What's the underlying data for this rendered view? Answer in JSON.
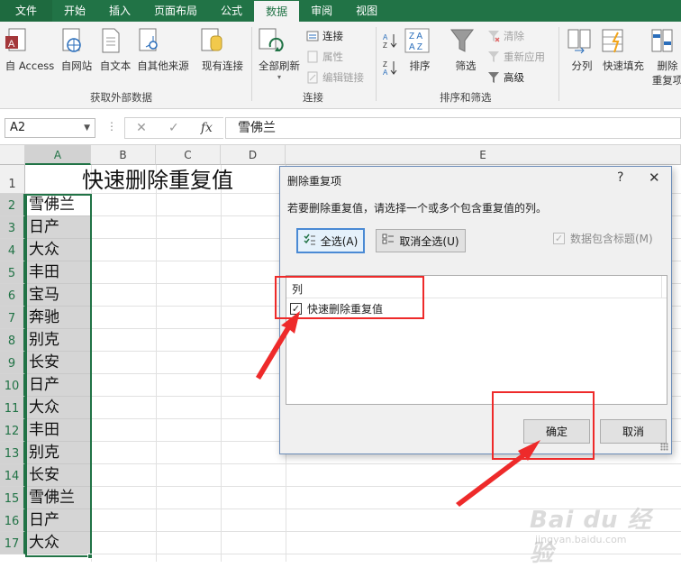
{
  "tabs": [
    "文件",
    "开始",
    "插入",
    "页面布局",
    "公式",
    "数据",
    "审阅",
    "视图"
  ],
  "active_tab": "数据",
  "ribbon": {
    "get_external": {
      "buttons": [
        "自 Access",
        "自网站",
        "自文本",
        "自其他来源",
        "现有连接"
      ],
      "label": "获取外部数据"
    },
    "connections": {
      "refresh_all": "全部刷新",
      "items": [
        "连接",
        "属性",
        "编辑链接"
      ],
      "label": "连接"
    },
    "sort_filter": {
      "sort": "排序",
      "filter": "筛选",
      "items": [
        "清除",
        "重新应用",
        "高级"
      ],
      "label": "排序和筛选"
    },
    "tools": {
      "split": "分列",
      "flash_fill": "快速填充",
      "remove_dup_1": "删除",
      "remove_dup_2": "重复项"
    }
  },
  "formula_bar": {
    "name_box": "A2",
    "more": "⋮",
    "cancel": "✕",
    "enter": "✓",
    "fx": "fx",
    "formula": "雪佛兰"
  },
  "sheet": {
    "columns": [
      "A",
      "B",
      "C",
      "D",
      "E"
    ],
    "rows": [
      "1",
      "2",
      "3",
      "4",
      "5",
      "6",
      "7",
      "8",
      "9",
      "10",
      "11",
      "12",
      "13",
      "14",
      "15",
      "16",
      "17"
    ],
    "title": "快速删除重复值",
    "values": [
      "雪佛兰",
      "日产",
      "大众",
      "丰田",
      "宝马",
      "奔驰",
      "别克",
      "长安",
      "日产",
      "大众",
      "丰田",
      "别克",
      "长安",
      "雪佛兰",
      "日产",
      "大众"
    ]
  },
  "dialog": {
    "title": "删除重复项",
    "help": "?",
    "close": "✕",
    "instruction": "若要删除重复值，请选择一个或多个包含重复值的列。",
    "select_all": "全选(A)",
    "unselect_all": "取消全选(U)",
    "has_headers": "数据包含标题(M)",
    "list_header": "列",
    "list_items": [
      "快速删除重复值"
    ],
    "ok": "确定",
    "cancel": "取消"
  },
  "watermark": {
    "main": "Bai du 经验",
    "sub": "jingyan.baidu.com"
  },
  "colors": {
    "accent": "#217346",
    "annotation": "#ee2a2a"
  }
}
